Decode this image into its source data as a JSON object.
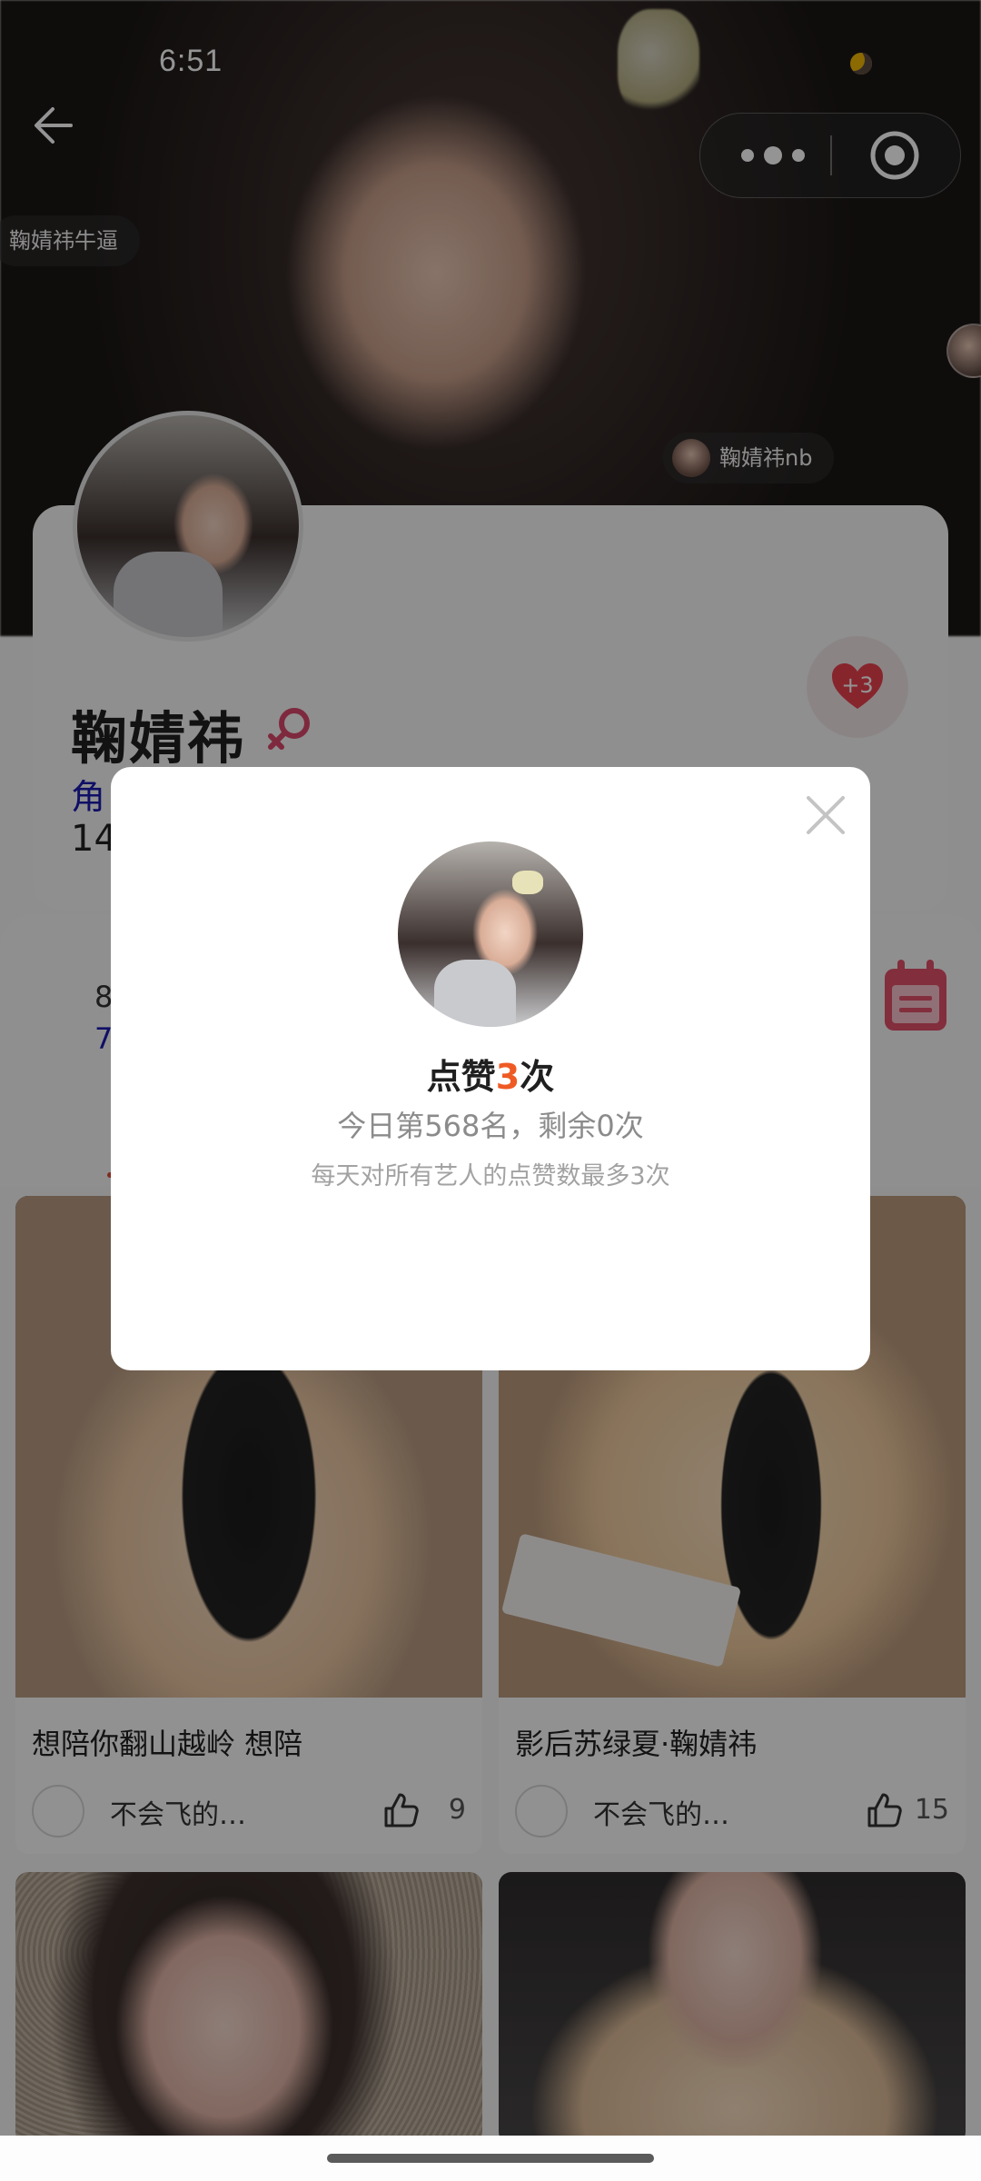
{
  "status_bar": {
    "time": "6:51"
  },
  "danmaku": [
    {
      "text": "鞠婧祎牛逼"
    },
    {
      "text": "鞠婧祎nb"
    }
  ],
  "profile": {
    "name": "鞠婧祎",
    "role_partial": "角",
    "count_partial": "14",
    "heart_badge": "+3"
  },
  "stats": {
    "a_partial": "8",
    "b_partial": "7"
  },
  "modal": {
    "title_prefix": "点赞",
    "title_count": "3",
    "title_suffix": "次",
    "subtitle": "今日第568名，剩余0次",
    "note": "每天对所有艺人的点赞数最多3次"
  },
  "feed": [
    {
      "title": "想陪你翻山越岭 想陪",
      "user": "不会飞的…",
      "likes": "9"
    },
    {
      "title": "影后苏绿夏·鞠婧祎",
      "user": "不会飞的…",
      "likes": "15"
    },
    {
      "title": "",
      "user": "",
      "likes": ""
    },
    {
      "title": "",
      "user": "",
      "likes": ""
    }
  ],
  "colors": {
    "accent_red": "#e04b3a",
    "count_orange": "#ef5a24",
    "heart": "#e8404e",
    "link_blue": "#1a1ab0",
    "calendar_pink": "#e0506a"
  },
  "icons": {
    "back": "back-arrow-icon",
    "more": "more-dots-icon",
    "target": "target-icon",
    "gender": "female-icon",
    "heart": "heart-icon",
    "calendar": "calendar-icon",
    "close": "close-icon",
    "like": "thumb-up-icon"
  }
}
